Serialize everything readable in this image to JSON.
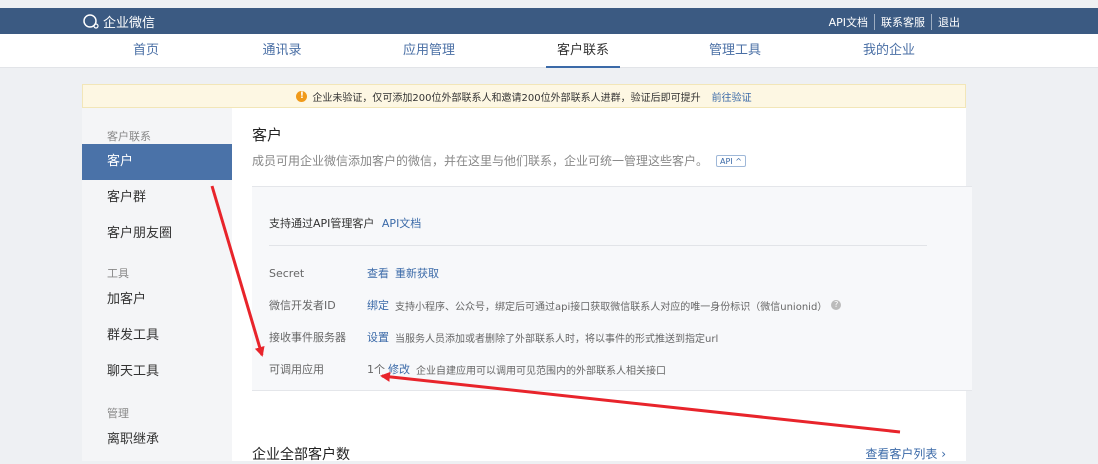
{
  "topbar": {
    "logo_text": "企业微信",
    "links": [
      "API文档",
      "联系客服",
      "退出"
    ]
  },
  "nav": {
    "items": [
      {
        "label": "首页",
        "active": false
      },
      {
        "label": "通讯录",
        "active": false
      },
      {
        "label": "应用管理",
        "active": false
      },
      {
        "label": "客户联系",
        "active": true
      },
      {
        "label": "管理工具",
        "active": false
      },
      {
        "label": "我的企业",
        "active": false
      }
    ]
  },
  "notice": {
    "text": "企业未验证，仅可添加200位外部联系人和邀请200位外部联系人进群，验证后即可提升",
    "link": "前往验证"
  },
  "sidebar": {
    "groups": [
      {
        "title": "客户联系",
        "items": [
          "客户",
          "客户群",
          "客户朋友圈"
        ]
      },
      {
        "title": "工具",
        "items": [
          "加客户",
          "群发工具",
          "聊天工具"
        ]
      },
      {
        "title": "管理",
        "items": [
          "离职继承"
        ]
      }
    ],
    "active_item": "客户"
  },
  "main": {
    "title": "客户",
    "description": "成员可用企业微信添加客户的微信，并在这里与他们联系，企业可统一管理这些客户。",
    "api_tag": "API ^",
    "api_box": {
      "heading": "支持通过API管理客户",
      "heading_link": "API文档",
      "rows": [
        {
          "label": "Secret",
          "actions": [
            "查看",
            "重新获取"
          ],
          "text": ""
        },
        {
          "label": "微信开发者ID",
          "actions": [
            "绑定"
          ],
          "text": "支持小程序、公众号，绑定后可通过api接口获取微信联系人对应的唯一身份标识（微信unionid）"
        },
        {
          "label": "接收事件服务器",
          "actions": [
            "设置"
          ],
          "text": "当服务人员添加或者删除了外部联系人时，将以事件的形式推送到指定url"
        },
        {
          "label": "可调用应用",
          "value": "1个",
          "actions": [
            "修改"
          ],
          "text": "企业自建应用可以调用可见范围内的外部联系人相关接口"
        }
      ]
    },
    "section_title": "企业全部客户数",
    "view_list_link": "查看客户列表 ›"
  },
  "colors": {
    "topbar": "#3b5a82",
    "accent": "#3b6aa8",
    "sidebar_active": "#4a72a8",
    "annotation_arrow": "#e8242b"
  }
}
